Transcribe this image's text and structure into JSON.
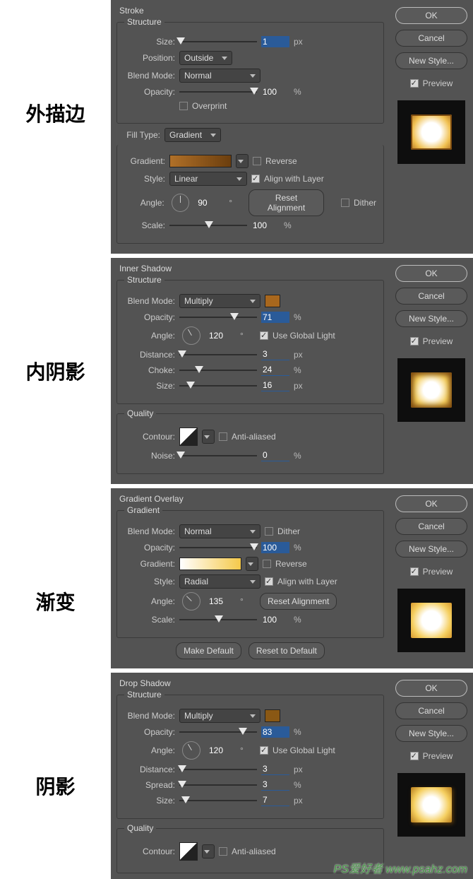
{
  "right": {
    "ok": "OK",
    "cancel": "Cancel",
    "newStyle": "New Style...",
    "preview": "Preview"
  },
  "labels": {
    "blendMode": "Blend Mode:",
    "opacity": "Opacity:",
    "angle": "Angle:",
    "size": "Size:",
    "distance": "Distance:",
    "scale": "Scale:",
    "contour": "Contour:",
    "noise": "Noise:",
    "style": "Style:",
    "gradient": "Gradient:",
    "position": "Position:",
    "fillType": "Fill Type:",
    "choke": "Choke:",
    "spread": "Spread:"
  },
  "units": {
    "px": "px",
    "pct": "%",
    "deg": "°"
  },
  "stroke": {
    "cn": "外描边",
    "title": "Stroke",
    "structure": "Structure",
    "size": "1",
    "position": "Outside",
    "blendMode": "Normal",
    "opacity": "100",
    "overprint": "Overprint",
    "fillType": "Gradient",
    "reverse": "Reverse",
    "alignLayer": "Align with Layer",
    "dither": "Dither",
    "styleVal": "Linear",
    "angle": "90",
    "resetAlign": "Reset Alignment",
    "scale": "100",
    "gradColors": [
      "#8b5a1a",
      "#6b3e0e"
    ]
  },
  "innerShadow": {
    "cn": "内阴影",
    "title": "Inner Shadow",
    "structure": "Structure",
    "blendMode": "Multiply",
    "chip": "#a8671d",
    "opacity": "71",
    "angle": "120",
    "globalLight": "Use Global Light",
    "distance": "3",
    "choke": "24",
    "size": "16",
    "quality": "Quality",
    "antiAliased": "Anti-aliased",
    "noise": "0"
  },
  "gradientOverlay": {
    "cn": "渐变",
    "title": "Gradient Overlay",
    "gradient": "Gradient",
    "blendMode": "Normal",
    "dither": "Dither",
    "opacity": "100",
    "reverse": "Reverse",
    "styleVal": "Radial",
    "alignLayer": "Align with Layer",
    "angle": "135",
    "resetAlign": "Reset Alignment",
    "scale": "100",
    "makeDefault": "Make Default",
    "resetDefault": "Reset to Default",
    "gradColors": [
      "#ffffff",
      "#f5c94a"
    ]
  },
  "dropShadow": {
    "cn": "阴影",
    "title": "Drop Shadow",
    "structure": "Structure",
    "blendMode": "Multiply",
    "chip": "#8a5814",
    "opacity": "83",
    "angle": "120",
    "globalLight": "Use Global Light",
    "distance": "3",
    "spread": "3",
    "size": "7",
    "quality": "Quality",
    "antiAliased": "Anti-aliased"
  },
  "watermark": "PS爱好者 www.psahz.com"
}
